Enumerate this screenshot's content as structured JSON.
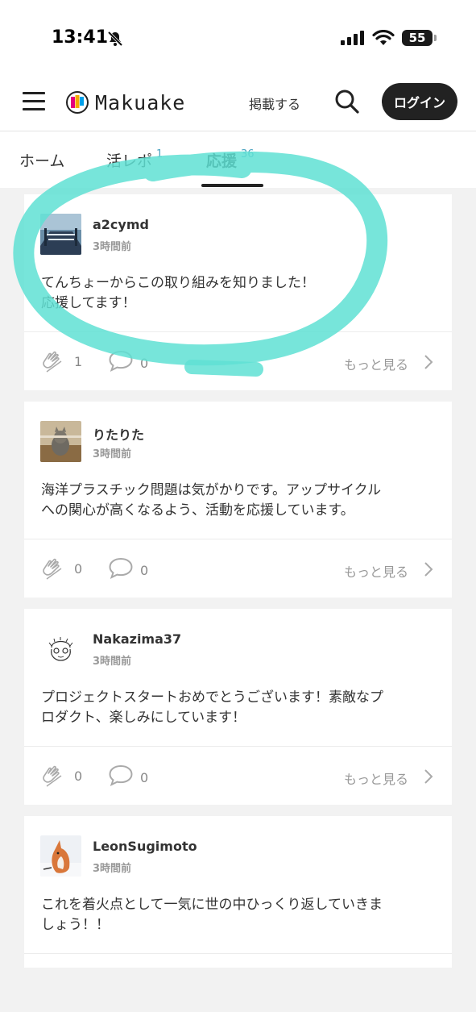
{
  "status_bar": {
    "time": "13:41",
    "battery": "55"
  },
  "header": {
    "logo_text": "Makuake",
    "post_label": "掲載する",
    "login_label": "ログイン"
  },
  "tabs": [
    {
      "label": "ホーム",
      "count": ""
    },
    {
      "label": "活レポ",
      "count": "1"
    },
    {
      "label": "応援",
      "count": "36"
    }
  ],
  "posts": [
    {
      "username": "a2cymd",
      "time": "3時間前",
      "text_lines": [
        "てんちょーからこの取り組みを知りました！",
        "応援してます！"
      ],
      "claps": "1",
      "comments": "0",
      "more_label": "もっと見る"
    },
    {
      "username": "りたりた",
      "time": "3時間前",
      "text_lines": [
        "海洋プラスチック問題は気がかりです。アップサイクル",
        "への関心が高くなるよう、活動を応援しています。"
      ],
      "claps": "0",
      "comments": "0",
      "more_label": "もっと見る"
    },
    {
      "username": "Nakazima37",
      "time": "3時間前",
      "text_lines": [
        "プロジェクトスタートおめでとうございます！素敵なプ",
        "ロダクト、楽しみにしています！"
      ],
      "claps": "0",
      "comments": "0",
      "more_label": "もっと見る"
    },
    {
      "username": "LeonSugimoto",
      "time": "3時間前",
      "text_lines": [
        "これを着火点として一気に世の中ひっくり返していきま",
        "しょう！！"
      ]
    }
  ],
  "colors": {
    "highlight": "#5fe0d4",
    "tab_count": "#4aa3c0",
    "login_bg": "#222222"
  }
}
